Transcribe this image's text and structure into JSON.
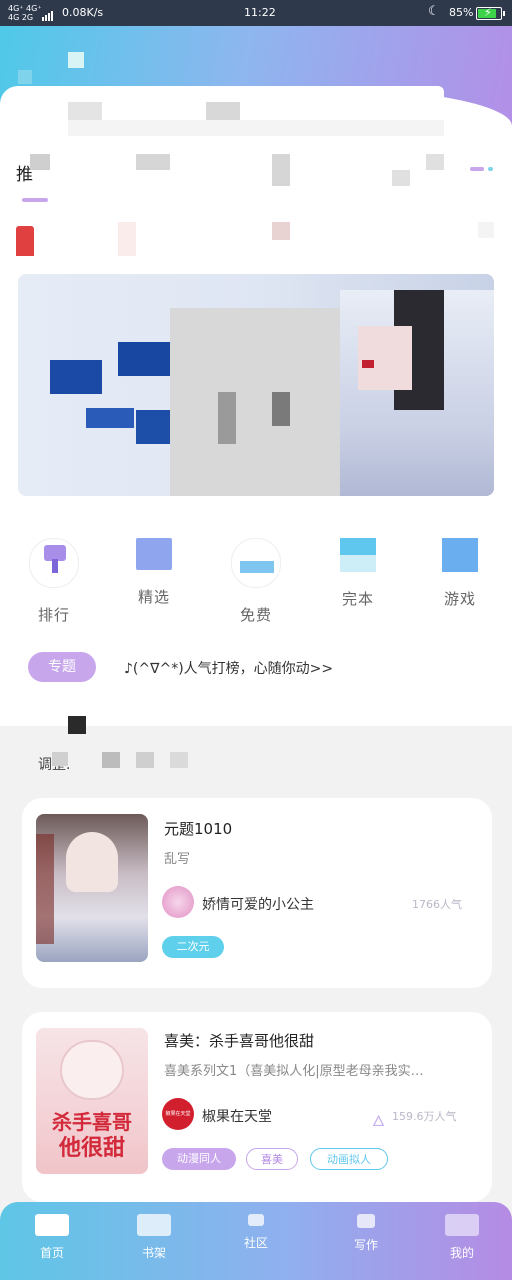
{
  "status_bar": {
    "signal_top": "4G⁺ 4G⁺",
    "signal_bottom": "4G  2G",
    "speed": "0.08K/s",
    "time": "11:22",
    "battery": "85%",
    "battery_level": 0.85
  },
  "home": {
    "first_tab_partial": "推"
  },
  "categories": [
    {
      "label": "排行",
      "icon": "ranking-icon",
      "color": "#a88ee8"
    },
    {
      "label": "精选",
      "icon": "featured-icon",
      "color": "#8fa6ef"
    },
    {
      "label": "免费",
      "icon": "free-icon",
      "color": "#7ec6f0"
    },
    {
      "label": "完本",
      "icon": "completed-icon",
      "color": "#5fc6ee"
    },
    {
      "label": "游戏",
      "icon": "game-icon",
      "color": "#6aaef0"
    }
  ],
  "topic": {
    "badge": "专题",
    "text": "♪(^∇^*)人气打榜，心随你动>>"
  },
  "section": {
    "label": "调整."
  },
  "books": [
    {
      "title": "元题1010",
      "desc": "乱写",
      "author": "娇情可爱的小公主",
      "popularity": "1766人气",
      "tags": [
        "二次元"
      ]
    },
    {
      "title": "喜美：杀手喜哥他很甜",
      "desc": "喜美系列文1（喜美拟人化|原型老母亲我实…",
      "author": "椒果在天堂",
      "popularity": "159.6万人气",
      "cover_text_1": "杀手喜哥",
      "cover_text_2": "他很甜",
      "avatar_text": "椒果在天堂",
      "tags": [
        "动漫同人",
        "喜美",
        "动画拟人"
      ]
    }
  ],
  "nav": [
    {
      "label": "首页",
      "icon": "home-icon"
    },
    {
      "label": "书架",
      "icon": "bookshelf-icon"
    },
    {
      "label": "社区",
      "icon": "community-icon"
    },
    {
      "label": "写作",
      "icon": "write-icon"
    },
    {
      "label": "我的",
      "icon": "profile-icon"
    }
  ]
}
